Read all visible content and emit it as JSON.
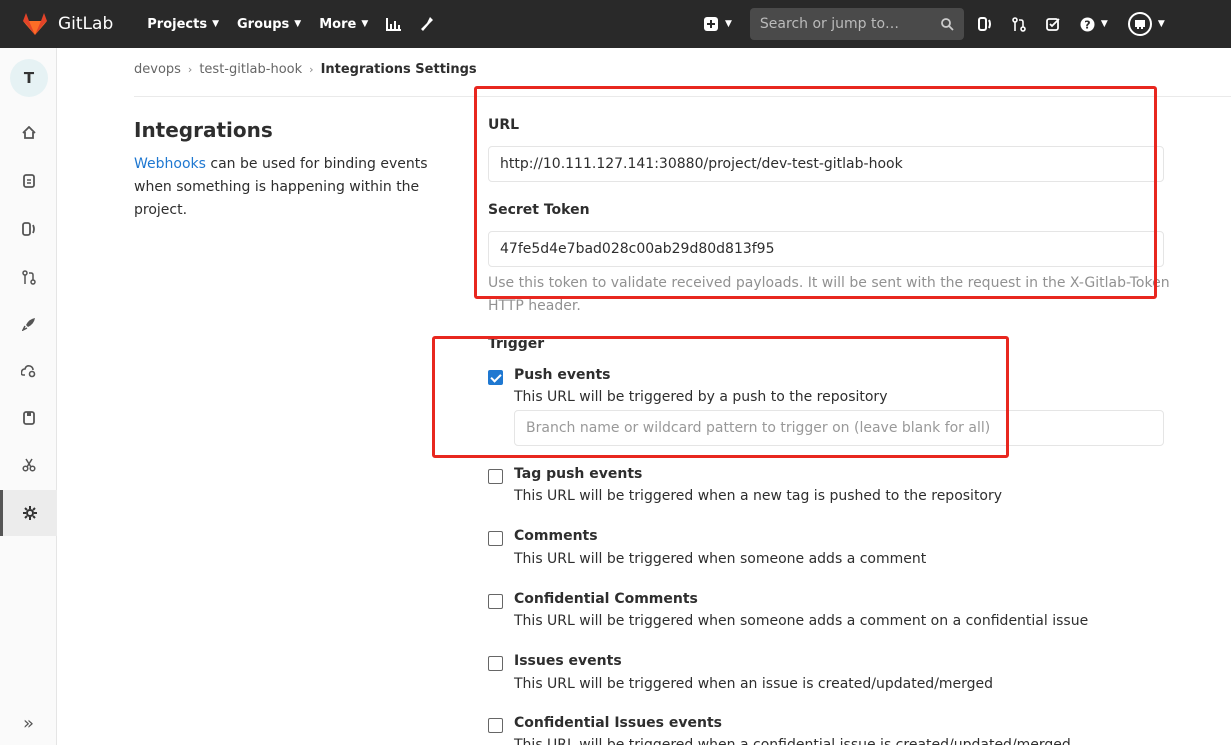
{
  "topbar": {
    "brand": "GitLab",
    "nav": [
      {
        "label": "Projects"
      },
      {
        "label": "Groups"
      },
      {
        "label": "More"
      }
    ],
    "search_placeholder": "Search or jump to…"
  },
  "sidebar": {
    "avatar_letter": "T"
  },
  "breadcrumb": {
    "items": [
      "devops",
      "test-gitlab-hook"
    ],
    "current": "Integrations Settings"
  },
  "integrations": {
    "title": "Integrations",
    "link_text": "Webhooks",
    "desc": "can be used for binding events when something is happening within the project."
  },
  "form": {
    "url_label": "URL",
    "url_value": "http://10.111.127.141:30880/project/dev-test-gitlab-hook",
    "token_label": "Secret Token",
    "token_value": "47fe5d4e7bad028c00ab29d80d813f95",
    "token_help": "Use this token to validate received payloads. It will be sent with the request in the X-Gitlab-Token HTTP header.",
    "trigger_label": "Trigger",
    "branch_placeholder": "Branch name or wildcard pattern to trigger on (leave blank for all)",
    "triggers": [
      {
        "title": "Push events",
        "desc": "This URL will be triggered by a push to the repository",
        "checked": true
      },
      {
        "title": "Tag push events",
        "desc": "This URL will be triggered when a new tag is pushed to the repository",
        "checked": false
      },
      {
        "title": "Comments",
        "desc": "This URL will be triggered when someone adds a comment",
        "checked": false
      },
      {
        "title": "Confidential Comments",
        "desc": "This URL will be triggered when someone adds a comment on a confidential issue",
        "checked": false
      },
      {
        "title": "Issues events",
        "desc": "This URL will be triggered when an issue is created/updated/merged",
        "checked": false
      },
      {
        "title": "Confidential Issues events",
        "desc": "This URL will be triggered when a confidential issue is created/updated/merged",
        "checked": false
      }
    ]
  },
  "colors": {
    "highlight": "#e8271f",
    "link": "#1f78d1",
    "topbar": "#292929"
  }
}
